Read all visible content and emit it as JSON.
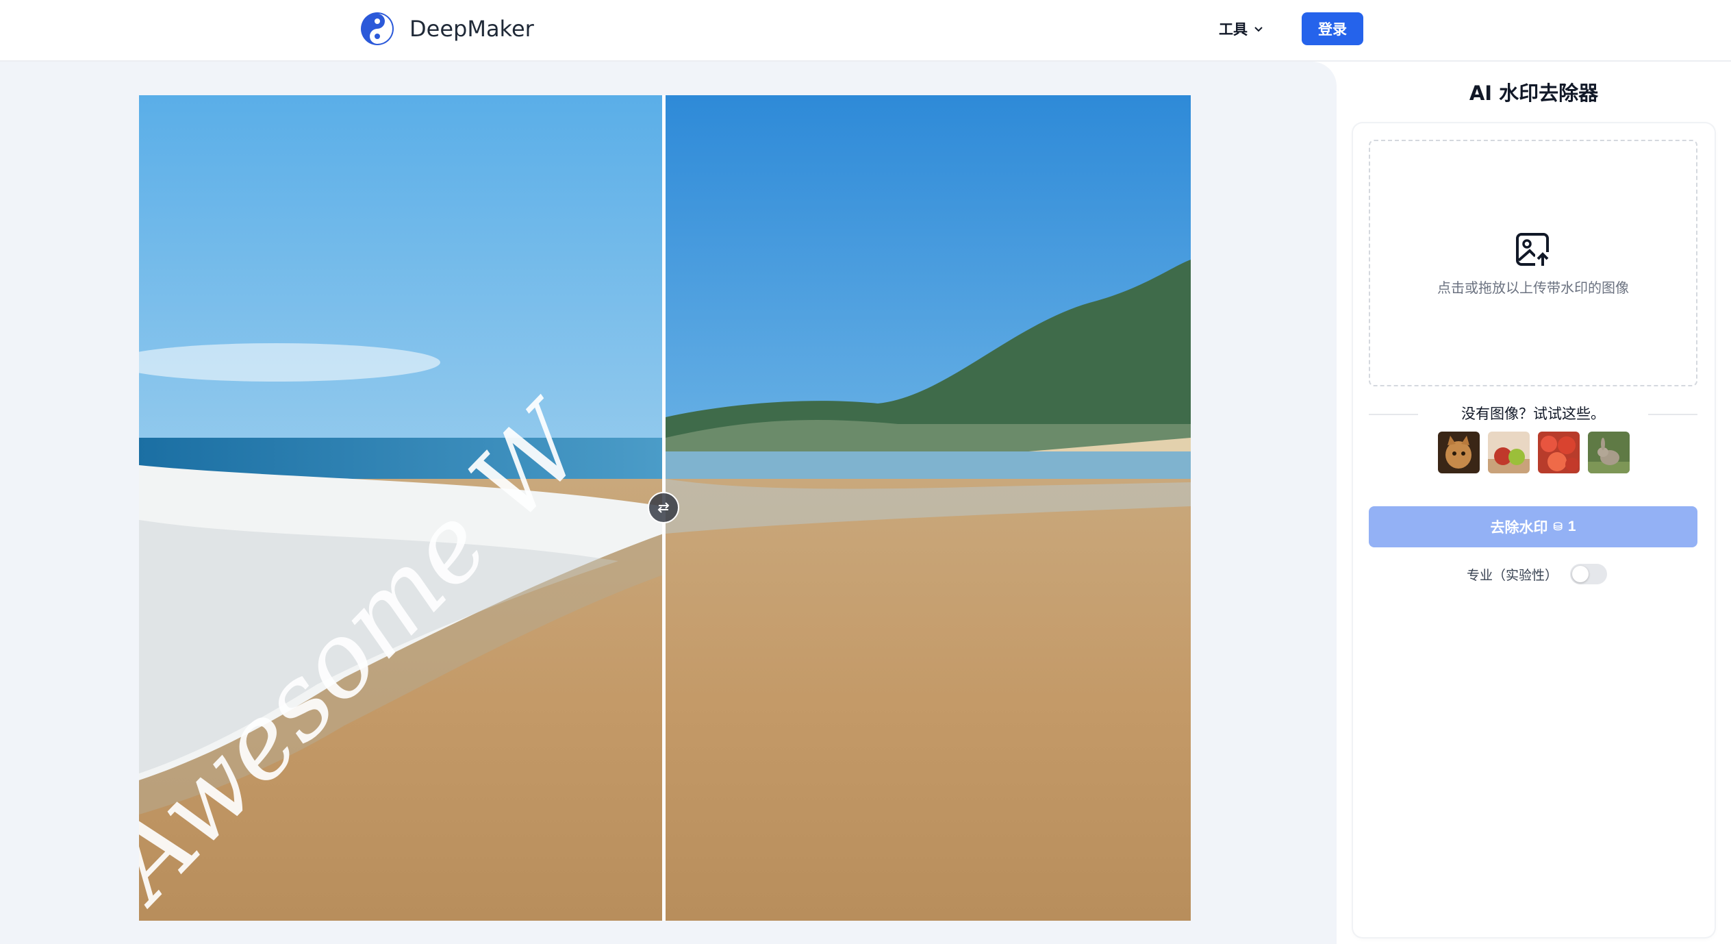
{
  "header": {
    "brand": "DeepMaker",
    "tools_label": "工具",
    "login_label": "登录"
  },
  "compare": {
    "watermark_text": "Awesome W"
  },
  "panel": {
    "title": "AI 水印去除器",
    "dropzone_text": "点击或拖放以上传带水印的图像",
    "samples_prompt": "没有图像？试试这些。",
    "sample_images": [
      "cat",
      "apples",
      "strawberries",
      "rabbit"
    ],
    "remove_button_label": "去除水印",
    "remove_button_cost": "1",
    "pro_label": "专业（实验性）",
    "pro_enabled": false
  },
  "colors": {
    "accent": "#2563eb",
    "disabled_button": "#93b1f5",
    "canvas_bg": "#f1f4f9"
  },
  "icons": {
    "logo": "yin-yang-logo-icon",
    "tools_chevron": "chevron-down-icon",
    "upload": "image-upload-icon",
    "divider_handle": "swap-arrows-icon",
    "credit": "coin-icon"
  }
}
